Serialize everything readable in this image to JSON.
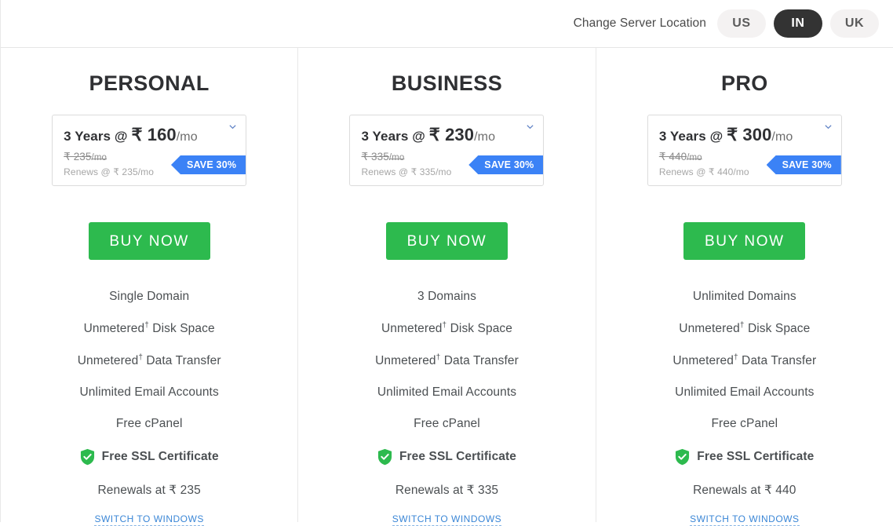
{
  "header": {
    "label": "Change Server Location",
    "locations": [
      {
        "code": "US",
        "active": false
      },
      {
        "code": "IN",
        "active": true
      },
      {
        "code": "UK",
        "active": false
      }
    ]
  },
  "colors": {
    "buy_green": "#2dba4e",
    "ribbon_blue": "#3b82f6",
    "active_pill": "#333333",
    "link_blue": "#3a86d6"
  },
  "plans": [
    {
      "title": "PERSONAL",
      "term": "3 Years @",
      "price": "₹ 160",
      "per": "/mo",
      "old_price": "₹ 235",
      "old_per": "/mo",
      "renews": "Renews @ ₹ 235/mo",
      "save_badge": "SAVE 30%",
      "buy_label": "BUY NOW",
      "features": [
        "Single Domain",
        "Unmetered† Disk Space",
        "Unmetered† Data Transfer",
        "Unlimited Email Accounts",
        "Free cPanel"
      ],
      "ssl": "Free SSL Certificate",
      "renewals_note": "Renewals at ₹ 235",
      "switch_label": "SWITCH TO WINDOWS"
    },
    {
      "title": "BUSINESS",
      "term": "3 Years @",
      "price": "₹ 230",
      "per": "/mo",
      "old_price": "₹ 335",
      "old_per": "/mo",
      "renews": "Renews @ ₹ 335/mo",
      "save_badge": "SAVE 30%",
      "buy_label": "BUY NOW",
      "features": [
        "3 Domains",
        "Unmetered† Disk Space",
        "Unmetered† Data Transfer",
        "Unlimited Email Accounts",
        "Free cPanel"
      ],
      "ssl": "Free SSL Certificate",
      "renewals_note": "Renewals at ₹ 335",
      "switch_label": "SWITCH TO WINDOWS"
    },
    {
      "title": "PRO",
      "term": "3 Years @",
      "price": "₹ 300",
      "per": "/mo",
      "old_price": "₹ 440",
      "old_per": "/mo",
      "renews": "Renews @ ₹ 440/mo",
      "save_badge": "SAVE 30%",
      "buy_label": "BUY NOW",
      "features": [
        "Unlimited Domains",
        "Unmetered† Disk Space",
        "Unmetered† Data Transfer",
        "Unlimited Email Accounts",
        "Free cPanel"
      ],
      "ssl": "Free SSL Certificate",
      "renewals_note": "Renewals at ₹ 440",
      "switch_label": "SWITCH TO WINDOWS"
    }
  ]
}
